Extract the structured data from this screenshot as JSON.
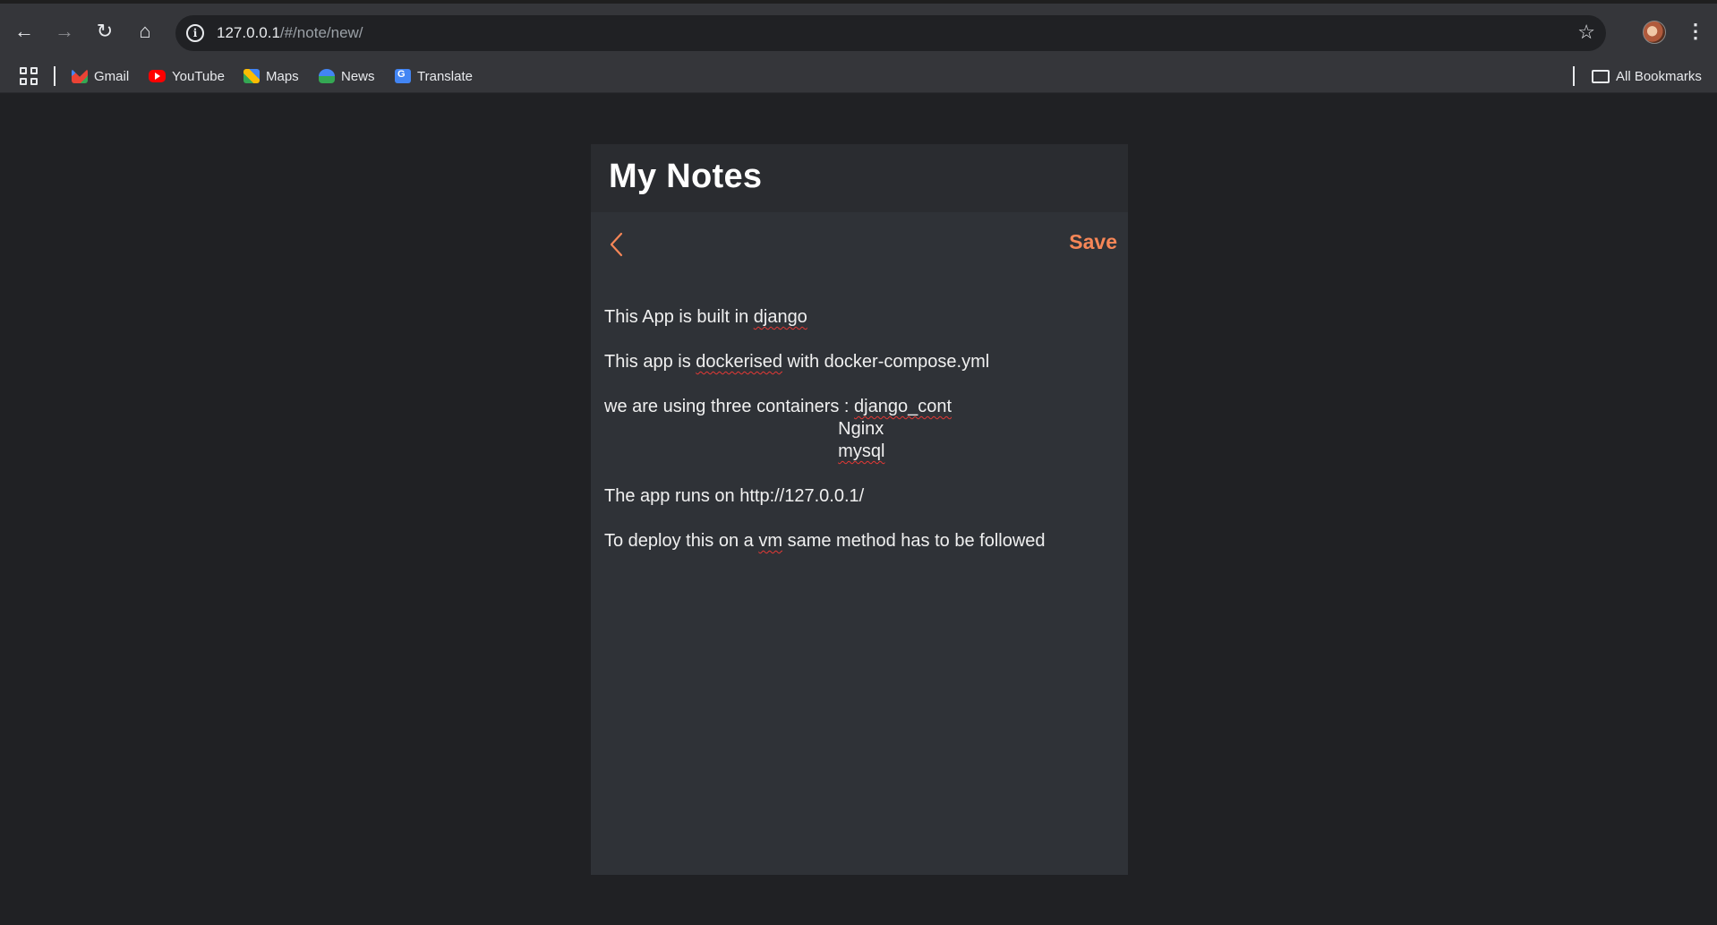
{
  "browser": {
    "url_host": "127.0.0.1",
    "url_path": "/#/note/new/",
    "bookmarks": [
      {
        "label": "Gmail",
        "icon": "gmail-icon"
      },
      {
        "label": "YouTube",
        "icon": "youtube-icon"
      },
      {
        "label": "Maps",
        "icon": "maps-icon"
      },
      {
        "label": "News",
        "icon": "news-icon"
      },
      {
        "label": "Translate",
        "icon": "translate-icon"
      }
    ],
    "all_bookmarks_label": "All Bookmarks"
  },
  "app": {
    "title": "My Notes",
    "accent_color": "#f68657",
    "back_icon": "chevron-left-icon",
    "save_label": "Save"
  },
  "note": {
    "lines": [
      {
        "pre": "This App is built in ",
        "sp": "django",
        "post": ""
      },
      {
        "pre": "This app is ",
        "sp": "dockerised",
        "post": " with docker-compose.yml"
      },
      {
        "pre": "we are using three containers : ",
        "sp": "django_cont",
        "post": ""
      },
      {
        "pre": "                                               Nginx",
        "sp": "",
        "post": ""
      },
      {
        "pre": "                                               ",
        "sp": "mysql",
        "post": ""
      },
      {
        "pre": "The app runs on http://127.0.0.1/",
        "sp": "",
        "post": ""
      },
      {
        "pre": "To deploy this on a ",
        "sp": "vm",
        "post": " same method has to be followed"
      }
    ]
  }
}
